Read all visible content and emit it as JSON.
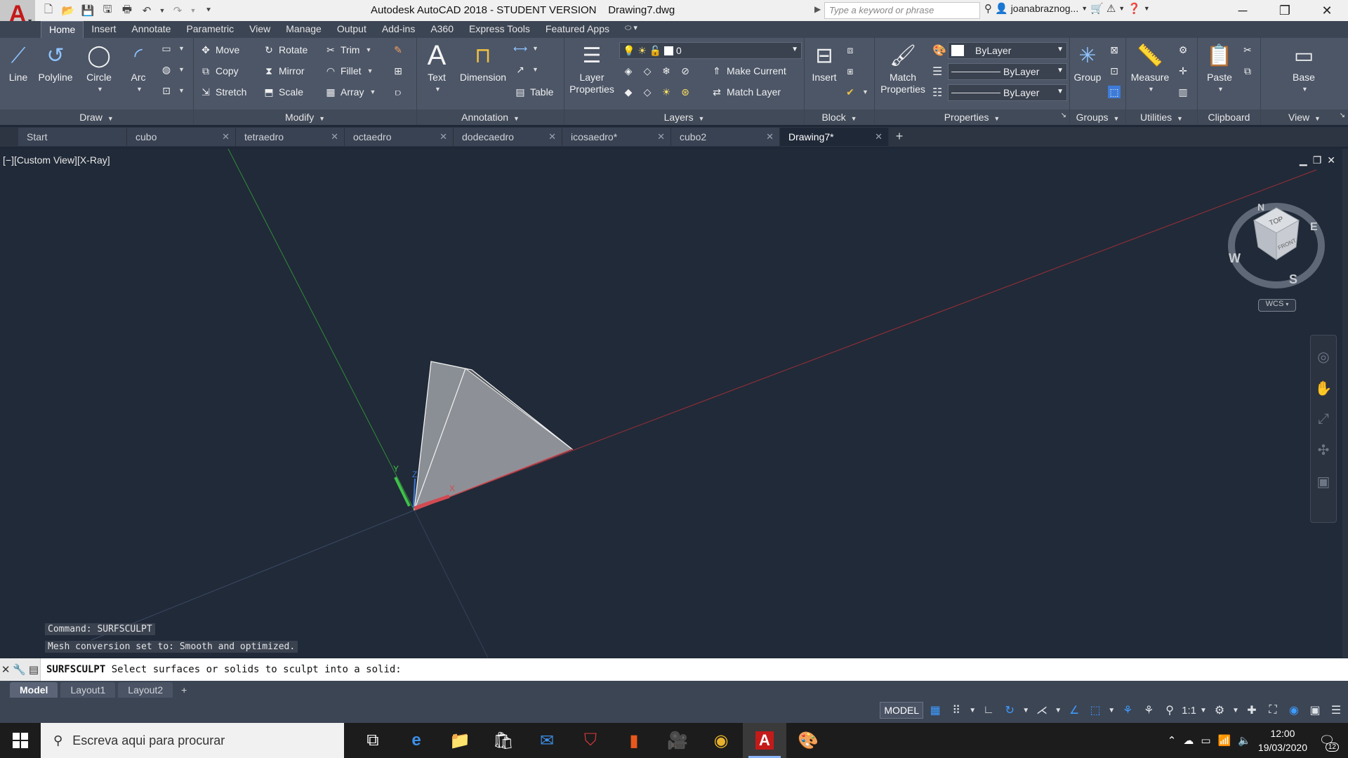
{
  "app": {
    "title": "Autodesk AutoCAD 2018 - STUDENT VERSION    Drawing7.dwg",
    "logo": "A",
    "search_placeholder": "Type a keyword or phrase",
    "user": "joanabraznog...",
    "accent_color": "#c41a1a"
  },
  "ribbon_tabs": [
    "Home",
    "Insert",
    "Annotate",
    "Parametric",
    "View",
    "Manage",
    "Output",
    "Add-ins",
    "A360",
    "Express Tools",
    "Featured Apps"
  ],
  "ribbon": {
    "draw": {
      "title": "Draw",
      "line": "Line",
      "polyline": "Polyline",
      "circle": "Circle",
      "arc": "Arc"
    },
    "modify": {
      "title": "Modify",
      "move": "Move",
      "rotate": "Rotate",
      "trim": "Trim",
      "copy": "Copy",
      "mirror": "Mirror",
      "fillet": "Fillet",
      "stretch": "Stretch",
      "scale": "Scale",
      "array": "Array"
    },
    "annotation": {
      "title": "Annotation",
      "text": "Text",
      "dimension": "Dimension",
      "table": "Table"
    },
    "layers": {
      "title": "Layers",
      "layer_properties_1": "Layer",
      "layer_properties_2": "Properties",
      "current_layer": "0",
      "make_current": "Make Current",
      "match_layer": "Match Layer"
    },
    "block": {
      "title": "Block",
      "insert": "Insert"
    },
    "properties": {
      "title": "Properties",
      "match_1": "Match",
      "match_2": "Properties",
      "color": "ByLayer",
      "linetype": "ByLayer",
      "lineweight": "ByLayer"
    },
    "groups": {
      "title": "Groups",
      "group": "Group"
    },
    "utilities": {
      "title": "Utilities",
      "measure": "Measure"
    },
    "clipboard": {
      "title": "Clipboard",
      "paste": "Paste"
    },
    "view": {
      "title": "View",
      "base": "Base"
    }
  },
  "file_tabs": [
    "Start",
    "cubo",
    "tetraedro",
    "octaedro",
    "dodecaedro",
    "icosaedro*",
    "cubo2",
    "Drawing7*"
  ],
  "viewport": {
    "label": "[−][Custom View][X-Ray]",
    "viewcube_top": "TOP",
    "viewcube_front": "FRONT",
    "compass_n": "N",
    "compass_e": "E",
    "compass_s": "S",
    "compass_w": "W",
    "wcs": "WCS",
    "ucs_x": "X",
    "ucs_y": "Y",
    "ucs_z": "Z"
  },
  "command_history": [
    "Command: SURFSCULPT",
    "Mesh conversion set to: Smooth and optimized."
  ],
  "command_line": {
    "command": "SURFSCULPT",
    "prompt": " Select surfaces or solids to sculpt into a solid:"
  },
  "layout_tabs": [
    "Model",
    "Layout1",
    "Layout2"
  ],
  "status": {
    "model": "MODEL",
    "scale": "1:1"
  },
  "taskbar": {
    "search_placeholder": "Escreva aqui para procurar",
    "time": "12:00",
    "date": "19/03/2020",
    "notifications": "12"
  }
}
